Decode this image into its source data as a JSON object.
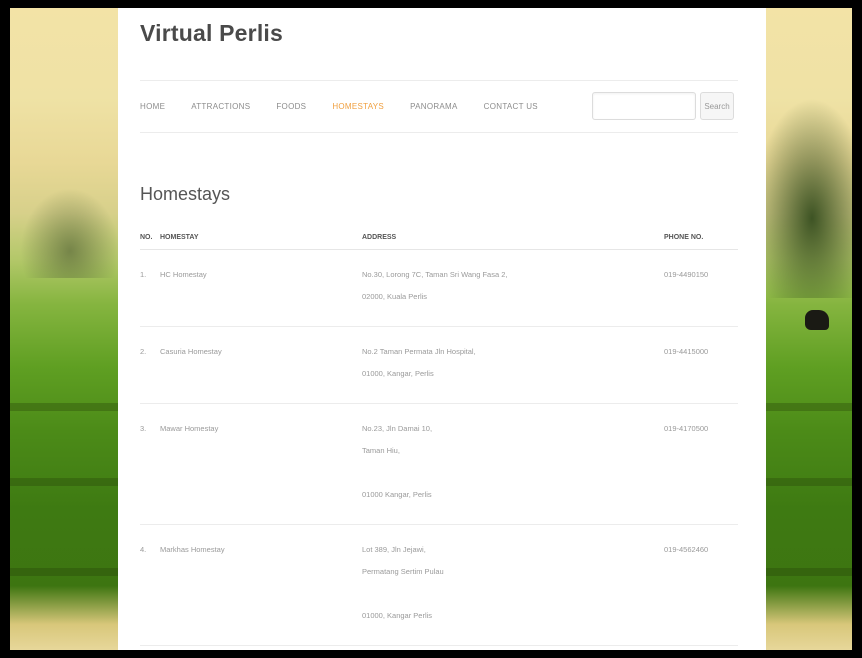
{
  "site": {
    "title": "Virtual Perlis"
  },
  "nav": [
    {
      "label": "HOME",
      "active": false
    },
    {
      "label": "ATTRACTIONS",
      "active": false
    },
    {
      "label": "FOODS",
      "active": false
    },
    {
      "label": "HOMESTAYS",
      "active": true
    },
    {
      "label": "PANORAMA",
      "active": false
    },
    {
      "label": "CONTACT US",
      "active": false
    }
  ],
  "search": {
    "value": "",
    "button_label": "Search"
  },
  "page": {
    "heading": "Homestays"
  },
  "table": {
    "headers": [
      "NO.",
      "HOMESTAY",
      "ADDRESS",
      "PHONE NO."
    ],
    "rows": [
      {
        "no": "1.",
        "name": "HC Homestay",
        "address": [
          "No.30, Lorong 7C, Taman Sri Wang Fasa 2,",
          "02000, Kuala Perlis"
        ],
        "phone": "019-4490150"
      },
      {
        "no": "2.",
        "name": "Casuria Homestay",
        "address": [
          "No.2 Taman Permata Jln Hospital,",
          "01000, Kangar, Perlis"
        ],
        "phone": "019-4415000"
      },
      {
        "no": "3.",
        "name": "Mawar Homestay",
        "address": [
          "No.23, Jln Damai 10,",
          "Taman Hiu,",
          "",
          "01000 Kangar, Perlis"
        ],
        "phone": "019-4170500"
      },
      {
        "no": "4.",
        "name": "Markhas Homestay",
        "address": [
          "Lot 389, Jln Jejawi,",
          "Permatang Sertim Pulau",
          "",
          "01000, Kangar Perlis"
        ],
        "phone": "019-4562460"
      }
    ]
  },
  "colors": {
    "accent": "#f0a040",
    "title": "#4a4a4a"
  }
}
